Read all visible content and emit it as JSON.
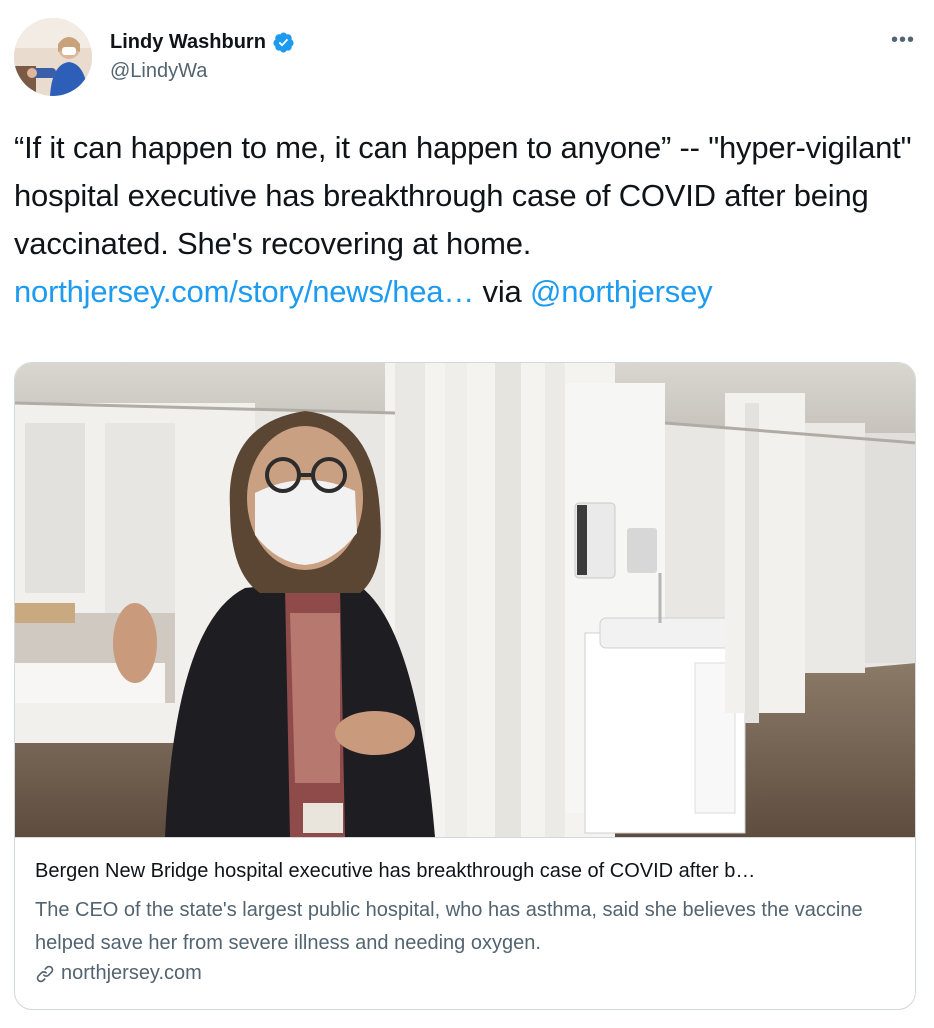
{
  "author": {
    "display_name": "Lindy Washburn",
    "handle": "@LindyWa",
    "verified": true,
    "avatar_icon": "profile-photo"
  },
  "more_label": "•••",
  "tweet": {
    "text_before_link": "“If it can happen to me, it can happen to anyone” -- \"hyper-vigilant\" hospital executive has breakthrough case of COVID after being vaccinated. She's recovering at home. ",
    "link_text": "northjersey.com/story/news/hea…",
    "text_via": " via ",
    "mention": "@northjersey"
  },
  "card": {
    "image_icon": "article-photo",
    "title": "Bergen New Bridge hospital executive has breakthrough case of COVID after b…",
    "description": "The CEO of the state's largest public hospital, who has asthma, said she believes the vaccine helped save her from severe illness and needing oxygen.",
    "domain": "northjersey.com",
    "domain_icon": "link-icon"
  },
  "colors": {
    "link": "#1d9bf0",
    "text": "#0f1419",
    "secondary": "#536471",
    "border": "#cfd9de"
  }
}
